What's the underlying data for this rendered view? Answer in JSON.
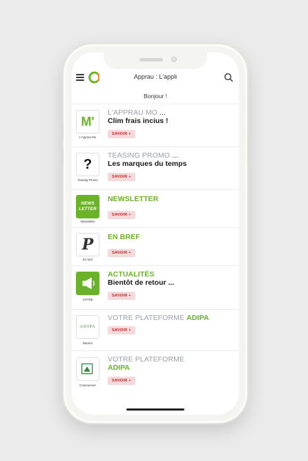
{
  "header": {
    "title": "Apprau : L'appli"
  },
  "greeting": "Bonjour !",
  "items": [
    {
      "heading_prefix": "L'APPRAU MO ",
      "heading_accent": "...",
      "subtitle": "Clim frais incius !",
      "button": "SAVOIR +",
      "thumb_label": "L'Apprau Mo",
      "thumb_text": "M'",
      "icon": "m-logo-icon"
    },
    {
      "heading_prefix": "TEASING PROMO ",
      "heading_accent": "...",
      "subtitle": "Les marques du temps",
      "button": "SAVOIR +",
      "thumb_label": "Teasing Promo",
      "thumb_text": "?",
      "icon": "question-icon"
    },
    {
      "heading": "NEWSLETTER",
      "button": "SAVOIR +",
      "thumb_label": "Newsletter",
      "thumb_text": "NEWS LETTER",
      "icon": "newsletter-icon"
    },
    {
      "heading": "EN BREF",
      "button": "SAVOIR +",
      "thumb_label": "En bref",
      "thumb_text": "P",
      "icon": "en-bref-icon"
    },
    {
      "heading": "ACTUALITÉS",
      "subtitle": "Bientôt de retour ...",
      "button": "SAVOIR +",
      "thumb_label": "VOTRE",
      "icon": "megaphone-icon"
    },
    {
      "heading_prefix": "VOTRE PLATEFORME ",
      "heading_accent": "ADIPA",
      "button": "SAVOIR +",
      "thumb_label": "Banres",
      "thumb_text": "ADIPA",
      "icon": "adipa-logo-icon"
    },
    {
      "heading": "VOTRE PLATEFORME",
      "subtitle": "ADIPA",
      "button": "SAVOIR +",
      "thumb_label": "Commencer",
      "icon": "adipa-app-icon"
    }
  ],
  "colors": {
    "accent": "#6ab227",
    "button_bg": "#f4dada",
    "button_text": "#c81f1f",
    "logo_orange": "#f08a24"
  }
}
